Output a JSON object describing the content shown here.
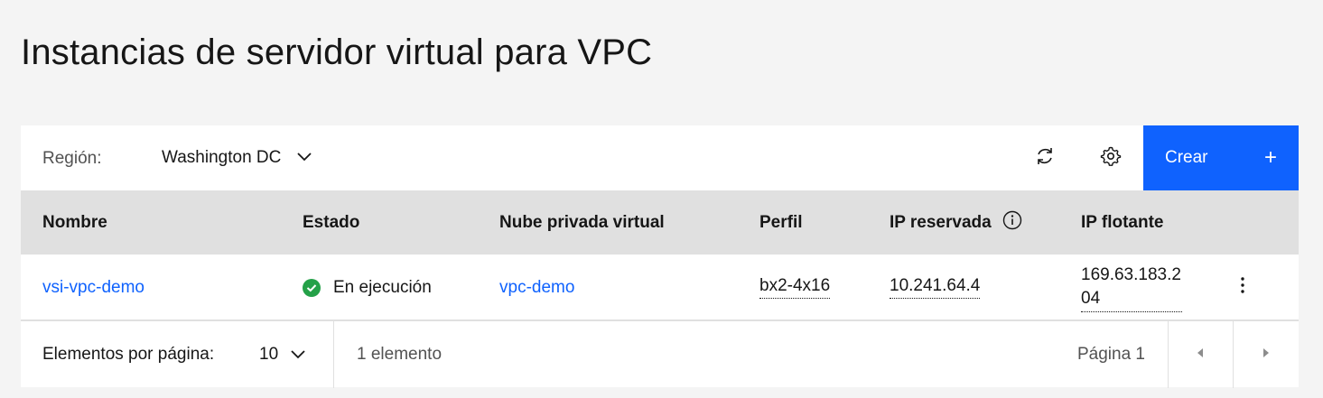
{
  "page": {
    "title": "Instancias de servidor virtual para VPC"
  },
  "toolbar": {
    "region_label": "Región:",
    "region_value": "Washington DC",
    "refresh_icon": "refresh-icon",
    "settings_icon": "gear-icon",
    "create_label": "Crear",
    "create_icon": "+"
  },
  "table": {
    "headers": {
      "name": "Nombre",
      "status": "Estado",
      "vpc": "Nube privada virtual",
      "profile": "Perfil",
      "reserved_ip": "IP reservada",
      "floating_ip": "IP flotante"
    },
    "rows": [
      {
        "name": "vsi-vpc-demo",
        "status": "En ejecución",
        "vpc": "vpc-demo",
        "profile": "bx2-4x16",
        "reserved_ip": "10.241.64.4",
        "floating_ip": "169.63.183.204"
      }
    ]
  },
  "pagination": {
    "items_per_page_label": "Elementos por página:",
    "items_per_page_value": "10",
    "count_text": "1 elemento",
    "page_text": "Página 1"
  },
  "colors": {
    "accent": "#0f62fe",
    "status_running": "#24a148",
    "header_bg": "#e0e0e0",
    "page_bg": "#f4f4f4"
  }
}
